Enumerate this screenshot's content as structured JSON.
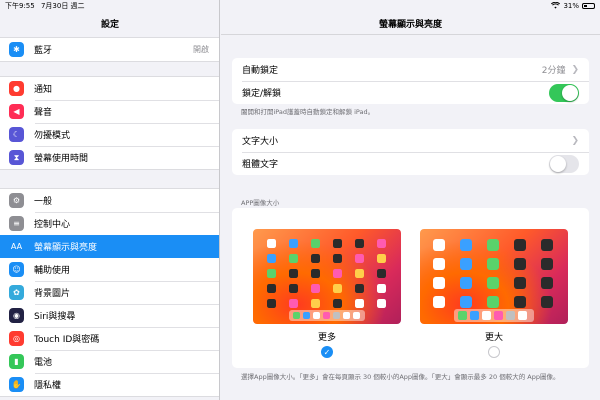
{
  "status": {
    "time": "下午9:55",
    "date": "7月30日 週二",
    "battery": "31%"
  },
  "sidebar": {
    "title": "設定",
    "groups": [
      [
        {
          "label": "藍牙",
          "value": "開啟",
          "icon": "bluetooth-icon",
          "color": "#1a8ef5",
          "glyph": "✱"
        }
      ],
      [
        {
          "label": "通知",
          "icon": "notifications-icon",
          "color": "#ff3b30",
          "glyph": "●"
        },
        {
          "label": "聲音",
          "icon": "sound-icon",
          "color": "#ff2d55",
          "glyph": "◀"
        },
        {
          "label": "勿擾模式",
          "icon": "moon-icon",
          "color": "#5856d6",
          "glyph": "☾"
        },
        {
          "label": "螢幕使用時間",
          "icon": "hourglass-icon",
          "color": "#5856d6",
          "glyph": "⧗"
        }
      ],
      [
        {
          "label": "一般",
          "icon": "gear-icon",
          "color": "#8e8e93",
          "glyph": "⚙"
        },
        {
          "label": "控制中心",
          "icon": "switches-icon",
          "color": "#8e8e93",
          "glyph": "≡"
        },
        {
          "label": "螢幕顯示與亮度",
          "icon": "text-size-icon",
          "color": "#1a8ef5",
          "glyph": "AA",
          "selected": true
        },
        {
          "label": "輔助使用",
          "icon": "accessibility-icon",
          "color": "#1a8ef5",
          "glyph": "☺"
        },
        {
          "label": "背景圖片",
          "icon": "flower-icon",
          "color": "#34aadc",
          "glyph": "✿"
        },
        {
          "label": "Siri與搜尋",
          "icon": "siri-icon",
          "color": "#222244",
          "glyph": "◉"
        },
        {
          "label": "Touch ID與密碼",
          "icon": "fingerprint-icon",
          "color": "#ff3b30",
          "glyph": "◎"
        },
        {
          "label": "電池",
          "icon": "battery-icon",
          "color": "#34c759",
          "glyph": "▮"
        },
        {
          "label": "隱私權",
          "icon": "hand-icon",
          "color": "#1a8ef5",
          "glyph": "✋"
        }
      ]
    ]
  },
  "main": {
    "title": "螢幕顯示與亮度",
    "auto_lock": {
      "label": "自動鎖定",
      "value": "2分鐘"
    },
    "lock_unlock": {
      "label": "鎖定/解鎖",
      "on": true
    },
    "lock_footnote": "闔開和打開iPad護蓋時自動鎖定和解鎖 iPad。",
    "text_size": {
      "label": "文字大小"
    },
    "bold_text": {
      "label": "粗體文字",
      "on": false
    },
    "icon_section_header": "APP圖像大小",
    "options": [
      {
        "label": "更多",
        "selected": true
      },
      {
        "label": "更大",
        "selected": false
      }
    ],
    "icon_footnote": "選擇App圖像大小。「更多」會在每頁顯示 30 個較小的App圖像。「更大」會顯示最多 20 個較大的 App圖像。"
  },
  "colors": {
    "accent": "#1a8ef5",
    "toggle_on": "#34c759",
    "background": "#f2f2f7"
  }
}
